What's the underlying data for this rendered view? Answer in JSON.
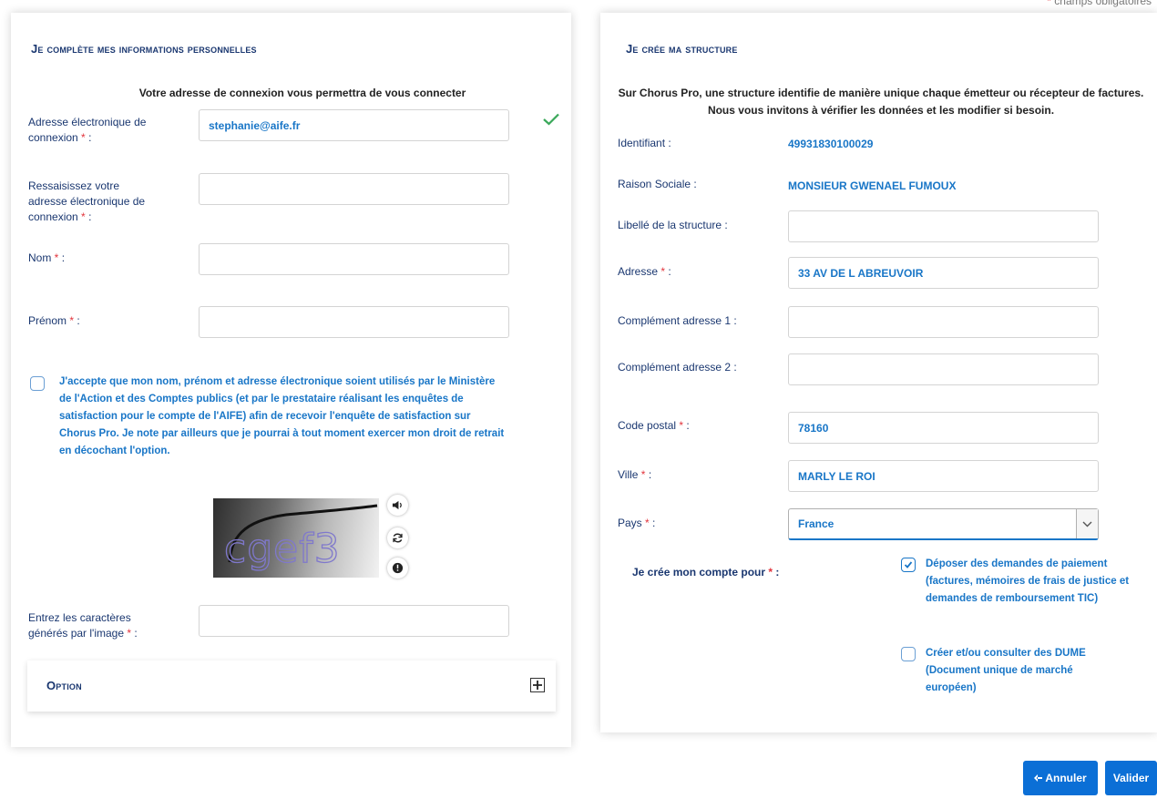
{
  "required_note": "champs obligatoires",
  "personal": {
    "title": "Je complète mes informations personnelles",
    "intro": "Votre adresse de connexion vous permettra de vous connecter",
    "email_label": "Adresse électronique de connexion",
    "email_value": "stephanie@aife.fr",
    "confirm_email_label": "Ressaisissez votre adresse électronique de connexion",
    "nom_label": "Nom",
    "prenom_label": "Prénom",
    "consent_text": "J'accepte que mon nom, prénom et adresse électronique soient utilisés par le Ministère de l'Action et des Comptes publics (et par le prestataire réalisant les enquêtes de satisfaction pour le compte de l'AIFE) afin de recevoir l'enquête de satisfaction sur Chorus Pro. Je note par ailleurs que je pourrai à tout moment exercer mon droit de retrait en décochant l'option.",
    "captcha_text": "cgef3",
    "captcha_label": "Entrez les caractères générés par l'image",
    "option_title": "Option"
  },
  "structure": {
    "title": "Je crée ma structure",
    "intro": "Sur Chorus Pro, une structure identifie de manière unique chaque émetteur ou récepteur de factures. Nous vous invitons à vérifier les données et les modifier si besoin.",
    "identifiant_label": "Identifiant :",
    "identifiant_value": "49931830100029",
    "raison_label": "Raison Sociale :",
    "raison_value": "MONSIEUR GWENAEL FUMOUX",
    "libelle_label": "Libellé de la structure :",
    "adresse_label": "Adresse",
    "adresse_value": "33  AV DE L ABREUVOIR",
    "complement1_label": "Complément adresse 1 :",
    "complement2_label": "Complément adresse 2 :",
    "cp_label": "Code postal",
    "cp_value": "78160",
    "ville_label": "Ville",
    "ville_value": "MARLY LE ROI",
    "pays_label": "Pays",
    "pays_value": "France",
    "compte_label": "Je crée mon compte pour",
    "option1_text": "Déposer des demandes de paiement (factures, mémoires de frais de justice et demandes de remboursement TIC)",
    "option1_checked": true,
    "option2_text": "Créer et/ou consulter des DUME (Document unique de marché européen)",
    "option2_checked": false
  },
  "actions": {
    "cancel_label": "Annuler",
    "validate_label": "Valider"
  },
  "colors": {
    "title": "#1a3770",
    "link_value": "#1976c7",
    "required": "#e2343c",
    "primary_button": "#0b6fd6",
    "success_check": "#3aa85a"
  }
}
